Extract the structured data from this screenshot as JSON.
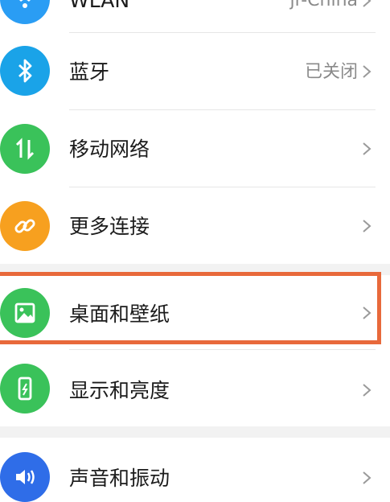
{
  "settings": {
    "wlan": {
      "label": "WLAN",
      "value": "jr-China",
      "icon": "wifi-icon",
      "icon_color": "#2a9df4"
    },
    "bluetooth": {
      "label": "蓝牙",
      "value": "已关闭",
      "icon": "bluetooth-icon",
      "icon_color": "#1aa3e8"
    },
    "mobile_network": {
      "label": "移动网络",
      "icon": "mobile-data-icon",
      "icon_color": "#3ac25a"
    },
    "more_connections": {
      "label": "更多连接",
      "icon": "link-icon",
      "icon_color": "#f7a01f"
    },
    "desktop_wallpaper": {
      "label": "桌面和壁纸",
      "icon": "image-icon",
      "icon_color": "#3ac25a"
    },
    "display_brightness": {
      "label": "显示和亮度",
      "icon": "phone-brightness-icon",
      "icon_color": "#3ac25a"
    },
    "sound_vibration": {
      "label": "声音和振动",
      "icon": "speaker-icon",
      "icon_color": "#2f6de8"
    }
  },
  "highlight_color": "#e8693b"
}
